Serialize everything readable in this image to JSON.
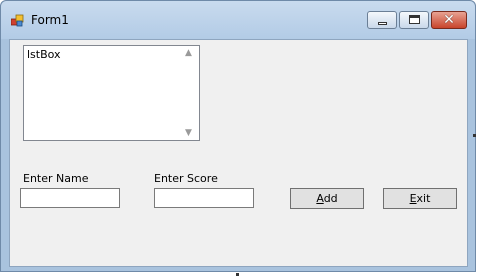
{
  "window": {
    "title": "Form1",
    "minimize_icon": "minimize-icon",
    "maximize_icon": "maximize-icon",
    "close_icon": "close-icon",
    "close_glyph": "✕"
  },
  "listbox": {
    "items": [
      "lstBox"
    ],
    "scroll_up_glyph": "▲",
    "scroll_down_glyph": "▼"
  },
  "labels": {
    "name": "Enter Name",
    "score": "Enter Score"
  },
  "inputs": {
    "name_value": "",
    "score_value": ""
  },
  "buttons": {
    "add_mnemonic": "A",
    "add_rest": "dd",
    "exit_mnemonic": "E",
    "exit_rest": "xit"
  },
  "colors": {
    "close_button": "#c8442b",
    "titlebar": "#b2cbe6",
    "client": "#f0f0f0"
  }
}
